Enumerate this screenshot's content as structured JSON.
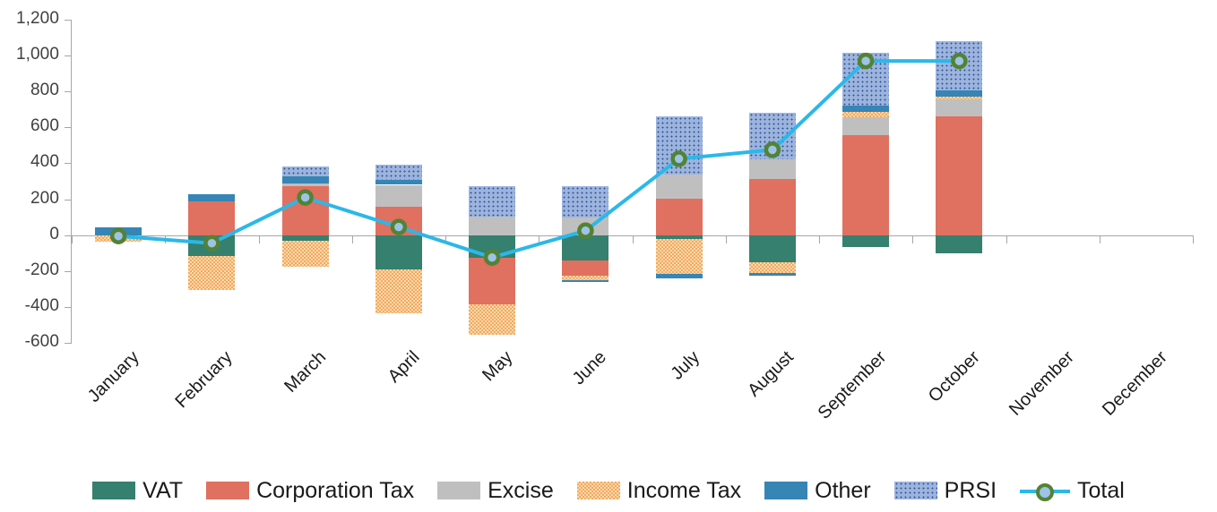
{
  "chart_data": {
    "type": "bar",
    "subtype": "stacked-bar-with-line",
    "title": "",
    "xlabel": "",
    "ylabel": "",
    "ylim": [
      -600,
      1200
    ],
    "ytick_step": 200,
    "ytick_labels": [
      "1,200",
      "1,000",
      "800",
      "600",
      "400",
      "200",
      "0",
      "-200",
      "-400",
      "-600"
    ],
    "ytick_values": [
      1200,
      1000,
      800,
      600,
      400,
      200,
      0,
      -200,
      -400,
      -600
    ],
    "grid": false,
    "legend_position": "bottom",
    "categories": [
      "January",
      "February",
      "March",
      "April",
      "May",
      "June",
      "July",
      "August",
      "September",
      "October",
      "November",
      "December"
    ],
    "series": [
      {
        "name": "VAT",
        "color": "#35806e",
        "pattern": "solid",
        "values": [
          0,
          -115,
          -30,
          -190,
          -125,
          -140,
          -20,
          -150,
          -65,
          -100,
          null,
          null
        ]
      },
      {
        "name": "Corporation Tax",
        "color": "#e0705f",
        "pattern": "solid",
        "values": [
          0,
          190,
          275,
          160,
          -260,
          -85,
          205,
          310,
          555,
          660,
          null,
          null
        ]
      },
      {
        "name": "Excise",
        "color": "#bfbfbf",
        "pattern": "solid",
        "values": [
          0,
          0,
          15,
          120,
          105,
          100,
          130,
          110,
          100,
          95,
          null,
          null
        ]
      },
      {
        "name": "Income Tax",
        "color": "#fbd9b0",
        "pattern": "checker",
        "values": [
          -35,
          -190,
          -145,
          -245,
          -170,
          -25,
          -195,
          -60,
          30,
          15,
          null,
          null
        ]
      },
      {
        "name": "Other",
        "color": "#3685b5",
        "pattern": "solid",
        "values": [
          45,
          40,
          35,
          25,
          0,
          -10,
          -25,
          -15,
          35,
          35,
          null,
          null
        ]
      },
      {
        "name": "PRSI",
        "color": "#9cb4dd",
        "pattern": "dotted",
        "values": [
          0,
          0,
          55,
          85,
          170,
          175,
          325,
          260,
          295,
          275,
          null,
          null
        ]
      }
    ],
    "line_series": {
      "name": "Total",
      "line_color": "#2bb8e8",
      "marker_fill": "#9dc3e6",
      "marker_stroke": "#548235",
      "values": [
        -5,
        -45,
        210,
        45,
        -125,
        25,
        425,
        475,
        970,
        970,
        null,
        null
      ]
    }
  },
  "legend": {
    "items": [
      {
        "label": "VAT",
        "kind": "swatch",
        "swatch_class": "s-vat",
        "icon": "legend-swatch-vat"
      },
      {
        "label": "Corporation Tax",
        "kind": "swatch",
        "swatch_class": "s-corp",
        "icon": "legend-swatch-corporation-tax"
      },
      {
        "label": "Excise",
        "kind": "swatch",
        "swatch_class": "s-excise",
        "icon": "legend-swatch-excise"
      },
      {
        "label": "Income Tax",
        "kind": "swatch",
        "swatch_class": "s-income",
        "icon": "legend-swatch-income-tax"
      },
      {
        "label": "Other",
        "kind": "swatch",
        "swatch_class": "s-other",
        "icon": "legend-swatch-other"
      },
      {
        "label": "PRSI",
        "kind": "swatch",
        "swatch_class": "s-prsi",
        "icon": "legend-swatch-prsi"
      },
      {
        "label": "Total",
        "kind": "line",
        "swatch_class": "s-total",
        "icon": "legend-line-marker-total"
      }
    ]
  }
}
